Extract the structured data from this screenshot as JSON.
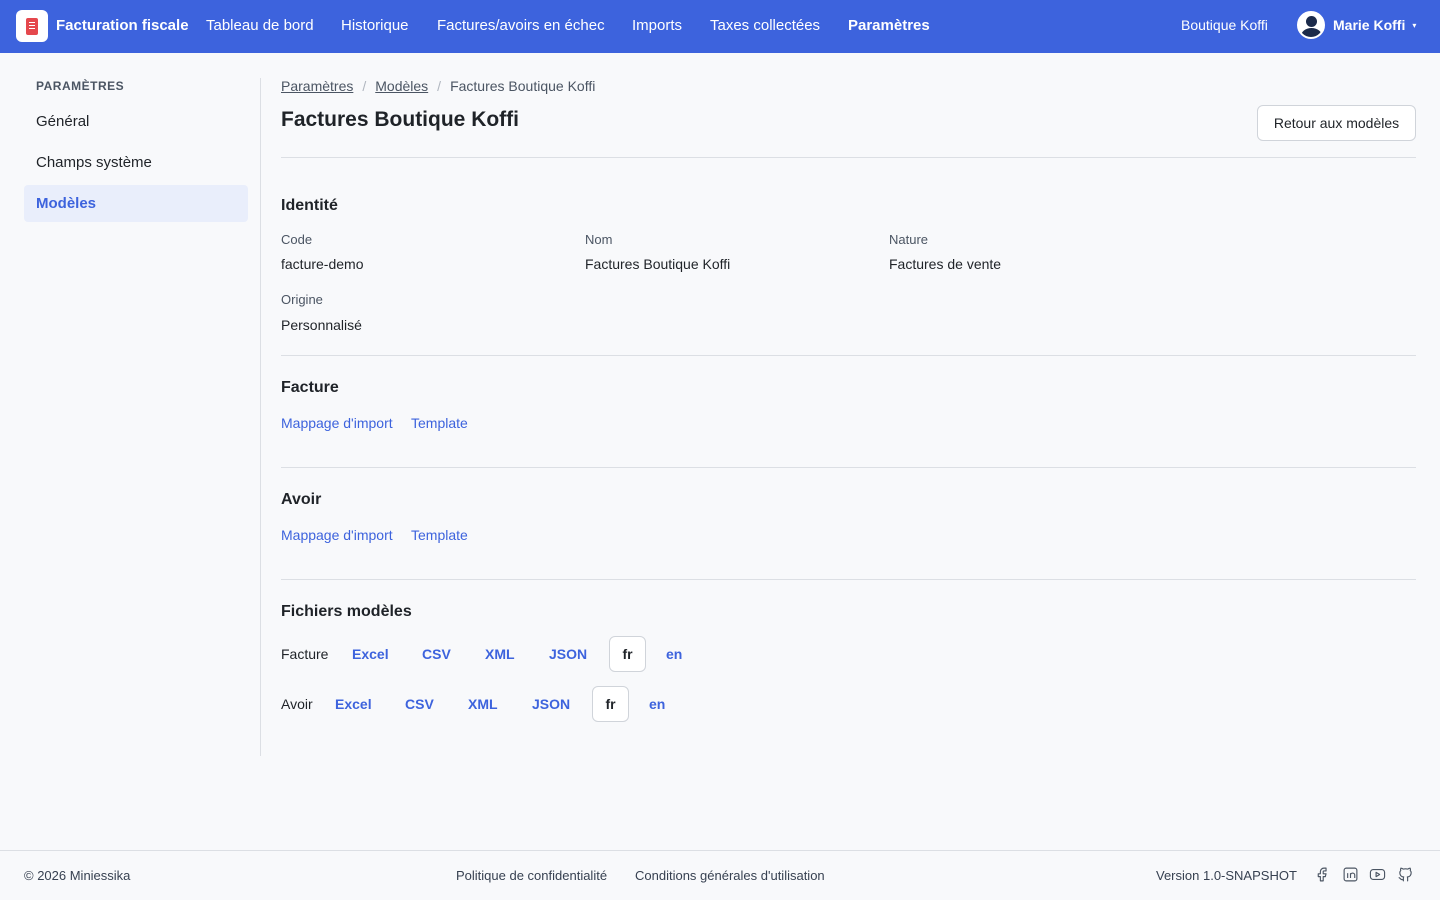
{
  "app": {
    "brand": "Facturation fiscale"
  },
  "nav": {
    "items": [
      {
        "label": "Tableau de bord"
      },
      {
        "label": "Historique"
      },
      {
        "label": "Factures/avoirs en échec"
      },
      {
        "label": "Imports"
      },
      {
        "label": "Taxes collectées"
      },
      {
        "label": "Paramètres"
      }
    ],
    "active": "Paramètres"
  },
  "header": {
    "shop": "Boutique Koffi",
    "user": "Marie Koffi",
    "caret": "▾"
  },
  "sidebar": {
    "title": "PARAMÈTRES",
    "items": [
      {
        "label": "Général"
      },
      {
        "label": "Champs système"
      },
      {
        "label": "Modèles"
      }
    ],
    "active": "Modèles"
  },
  "breadcrumb": {
    "items": [
      "Paramètres",
      "Modèles",
      "Factures Boutique Koffi"
    ],
    "separator": "/"
  },
  "page": {
    "title": "Factures Boutique Koffi",
    "back_button": "Retour aux modèles"
  },
  "identity": {
    "title": "Identité",
    "code_label": "Code",
    "code_value": "facture-demo",
    "name_label": "Nom",
    "name_value": "Factures Boutique Koffi",
    "nature_label": "Nature",
    "nature_value": "Factures de vente",
    "origin_label": "Origine",
    "origin_value": "Personnalisé"
  },
  "facture": {
    "title": "Facture",
    "links": [
      "Mappage d'import",
      "Template"
    ]
  },
  "avoir": {
    "title": "Avoir",
    "links": [
      "Mappage d'import",
      "Template"
    ]
  },
  "files": {
    "title": "Fichiers modèles",
    "rows": [
      {
        "label": "Facture",
        "formats": [
          "Excel",
          "CSV",
          "XML",
          "JSON"
        ],
        "langs": [
          "fr",
          "en"
        ],
        "selected_lang": "fr"
      },
      {
        "label": "Avoir",
        "formats": [
          "Excel",
          "CSV",
          "XML",
          "JSON"
        ],
        "langs": [
          "fr",
          "en"
        ],
        "selected_lang": "fr"
      }
    ]
  },
  "footer": {
    "copyright": "© 2026 Miniessika",
    "privacy": "Politique de confidentialité",
    "terms": "Conditions générales d'utilisation",
    "version": "Version 1.0-SNAPSHOT",
    "social_icons": [
      "facebook-icon",
      "linkedin-icon",
      "youtube-icon",
      "github-icon"
    ]
  },
  "colors": {
    "accent": "#3d63dd",
    "logo_red": "#e5484d",
    "background": "#f8f9fb"
  }
}
